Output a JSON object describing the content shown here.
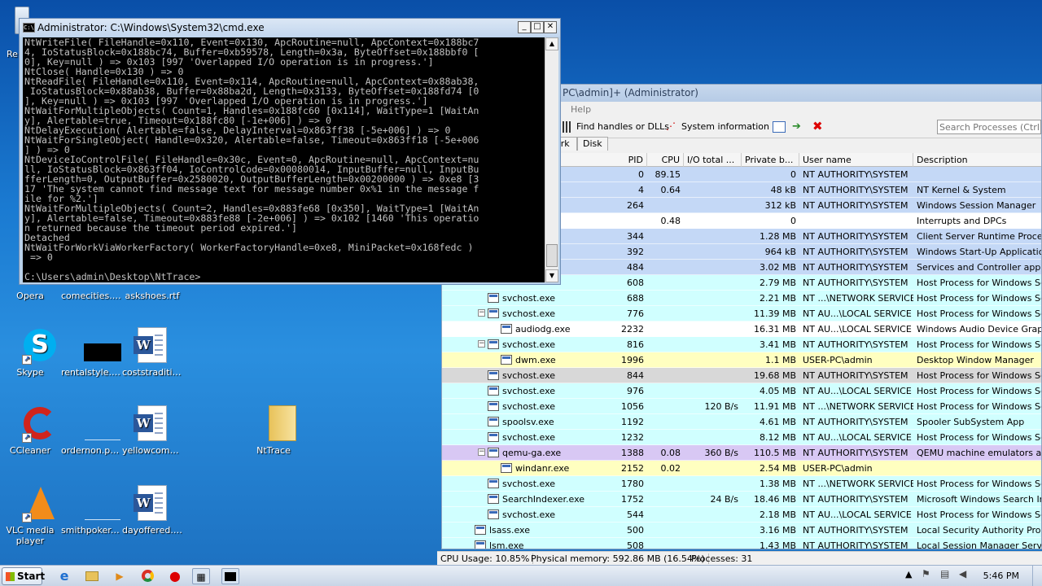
{
  "desktop": {
    "icons": [
      {
        "label": "Opera",
        "name": "opera"
      },
      {
        "label": "comecities.png",
        "name": "comecities"
      },
      {
        "label": "askshoes.rtf",
        "name": "askshoes"
      },
      {
        "label": "Skype",
        "name": "skype"
      },
      {
        "label": "rentalstyle.jpg",
        "name": "rentalstyle"
      },
      {
        "label": "coststraditio...",
        "name": "coststradition"
      },
      {
        "label": "CCleaner",
        "name": "ccleaner"
      },
      {
        "label": "ordernon.png",
        "name": "ordernon"
      },
      {
        "label": "yellowcomm...",
        "name": "yellowcomm"
      },
      {
        "label": "NtTrace",
        "name": "nttrace"
      },
      {
        "label": "VLC media player",
        "name": "vlc"
      },
      {
        "label": "smithpoker....",
        "name": "smithpoker"
      },
      {
        "label": "dayoffered.rtf",
        "name": "dayoffered"
      }
    ],
    "partial_left_label": "Re"
  },
  "cmd": {
    "title": "Administrator: C:\\Windows\\System32\\cmd.exe",
    "lines": [
      "NtWriteFile( FileHandle=0x110, Event=0x130, ApcRoutine=null, ApcContext=0x188bc7",
      "4, IoStatusBlock=0x188bc74, Buffer=0xb59578, Length=0x3a, ByteOffset=0x188bbf0 [",
      "0], Key=null ) => 0x103 [997 'Overlapped I/O operation is in progress.']",
      "NtClose( Handle=0x130 ) => 0",
      "NtReadFile( FileHandle=0x110, Event=0x114, ApcRoutine=null, ApcContext=0x88ab38,",
      " IoStatusBlock=0x88ab38, Buffer=0x88ba2d, Length=0x3133, ByteOffset=0x188fd74 [0",
      "], Key=null ) => 0x103 [997 'Overlapped I/O operation is in progress.']",
      "NtWaitForMultipleObjects( Count=1, Handles=0x188fc60 [0x114], WaitType=1 [WaitAn",
      "y], Alertable=true, Timeout=0x188fc80 [-1e+006] ) => 0",
      "NtDelayExecution( Alertable=false, DelayInterval=0x863ff38 [-5e+006] ) => 0",
      "NtWaitForSingleObject( Handle=0x320, Alertable=false, Timeout=0x863ff18 [-5e+006",
      "] ) => 0",
      "NtDeviceIoControlFile( FileHandle=0x30c, Event=0, ApcRoutine=null, ApcContext=nu",
      "ll, IoStatusBlock=0x863ff04, IoControlCode=0x00080014, InputBuffer=null, InputBu",
      "fferLength=0, OutputBuffer=0x2580020, OutputBufferLength=0x00200000 ) => 0xe8 [3",
      "17 'The system cannot find message text for message number 0x%1 in the message f",
      "ile for %2.']",
      "NtWaitForMultipleObjects( Count=2, Handles=0x883fe68 [0x350], WaitType=1 [WaitAn",
      "y], Alertable=false, Timeout=0x883fe88 [-2e+006] ) => 0x102 [1460 'This operatio",
      "n returned because the timeout period expired.']",
      "Detached",
      "NtWaitForWorkViaWorkerFactory( WorkerFactoryHandle=0xe8, MiniPacket=0x168fedc )",
      " => 0",
      "",
      "C:\\Users\\admin\\Desktop\\NtTrace>"
    ]
  },
  "procexp": {
    "title": "PC\\admin]+ (Administrator)",
    "menu_help": "Help",
    "toolbar": {
      "find_handles": "Find handles or DLLs",
      "system_info": "System information",
      "search_placeholder": "Search Processes (Ctrl+K)"
    },
    "tabs": [
      "ork",
      "Disk"
    ],
    "columns": [
      "PID",
      "CPU",
      "I/O total ...",
      "Private b...",
      "User name",
      "Description"
    ],
    "rows": [
      {
        "indent": 0,
        "name": "",
        "pid": "0",
        "cpu": "89.15",
        "io": "",
        "priv": "0",
        "user": "NT AUTHORITY\\SYSTEM",
        "desc": "",
        "color": "#c4d8f6"
      },
      {
        "indent": 0,
        "name": "",
        "pid": "4",
        "cpu": "0.64",
        "io": "",
        "priv": "48 kB",
        "user": "NT AUTHORITY\\SYSTEM",
        "desc": "NT Kernel & System",
        "color": "#c4d8f6"
      },
      {
        "indent": 0,
        "name": "",
        "pid": "264",
        "cpu": "",
        "io": "",
        "priv": "312 kB",
        "user": "NT AUTHORITY\\SYSTEM",
        "desc": "Windows Session Manager",
        "color": "#c4d8f6"
      },
      {
        "indent": 0,
        "name": "",
        "pid": "",
        "cpu": "0.48",
        "io": "",
        "priv": "0",
        "user": "",
        "desc": "Interrupts and DPCs",
        "color": "#ffffff"
      },
      {
        "indent": 0,
        "name": "",
        "pid": "344",
        "cpu": "",
        "io": "",
        "priv": "1.28 MB",
        "user": "NT AUTHORITY\\SYSTEM",
        "desc": "Client Server Runtime Process",
        "color": "#c4d8f6"
      },
      {
        "indent": 0,
        "name": "",
        "pid": "392",
        "cpu": "",
        "io": "",
        "priv": "964 kB",
        "user": "NT AUTHORITY\\SYSTEM",
        "desc": "Windows Start-Up Application",
        "color": "#c4d8f6"
      },
      {
        "indent": 0,
        "name": "",
        "pid": "484",
        "cpu": "",
        "io": "",
        "priv": "3.02 MB",
        "user": "NT AUTHORITY\\SYSTEM",
        "desc": "Services and Controller app",
        "color": "#c4d8f6"
      },
      {
        "indent": 0,
        "name": "",
        "pid": "608",
        "cpu": "",
        "io": "",
        "priv": "2.79 MB",
        "user": "NT AUTHORITY\\SYSTEM",
        "desc": "Host Process for Windows Servi",
        "color": "#d0ffff"
      },
      {
        "indent": 1,
        "name": "svchost.exe",
        "pid": "688",
        "cpu": "",
        "io": "",
        "priv": "2.21 MB",
        "user": "NT ...\\NETWORK SERVICE",
        "desc": "Host Process for Windows Servi",
        "color": "#d0ffff"
      },
      {
        "indent": 1,
        "expand": true,
        "name": "svchost.exe",
        "pid": "776",
        "cpu": "",
        "io": "",
        "priv": "11.39 MB",
        "user": "NT AU...\\LOCAL SERVICE",
        "desc": "Host Process for Windows Servi",
        "color": "#d0ffff"
      },
      {
        "indent": 2,
        "name": "audiodg.exe",
        "pid": "2232",
        "cpu": "",
        "io": "",
        "priv": "16.31 MB",
        "user": "NT AU...\\LOCAL SERVICE",
        "desc": "Windows Audio Device Graph Is",
        "color": "#ffffff"
      },
      {
        "indent": 1,
        "expand": true,
        "name": "svchost.exe",
        "pid": "816",
        "cpu": "",
        "io": "",
        "priv": "3.41 MB",
        "user": "NT AUTHORITY\\SYSTEM",
        "desc": "Host Process for Windows Servi",
        "color": "#d0ffff"
      },
      {
        "indent": 2,
        "name": "dwm.exe",
        "pid": "1996",
        "cpu": "",
        "io": "",
        "priv": "1.1 MB",
        "user": "USER-PC\\admin",
        "desc": "Desktop Window Manager",
        "color": "#ffffc0"
      },
      {
        "indent": 1,
        "name": "svchost.exe",
        "pid": "844",
        "cpu": "",
        "io": "",
        "priv": "19.68 MB",
        "user": "NT AUTHORITY\\SYSTEM",
        "desc": "Host Process for Windows Servi",
        "color": "#d8d8d8"
      },
      {
        "indent": 1,
        "name": "svchost.exe",
        "pid": "976",
        "cpu": "",
        "io": "",
        "priv": "4.05 MB",
        "user": "NT AU...\\LOCAL SERVICE",
        "desc": "Host Process for Windows Servi",
        "color": "#d0ffff"
      },
      {
        "indent": 1,
        "name": "svchost.exe",
        "pid": "1056",
        "cpu": "",
        "io": "120 B/s",
        "priv": "11.91 MB",
        "user": "NT ...\\NETWORK SERVICE",
        "desc": "Host Process for Windows Servi",
        "color": "#d0ffff"
      },
      {
        "indent": 1,
        "name": "spoolsv.exe",
        "pid": "1192",
        "cpu": "",
        "io": "",
        "priv": "4.61 MB",
        "user": "NT AUTHORITY\\SYSTEM",
        "desc": "Spooler SubSystem App",
        "color": "#d0ffff"
      },
      {
        "indent": 1,
        "name": "svchost.exe",
        "pid": "1232",
        "cpu": "",
        "io": "",
        "priv": "8.12 MB",
        "user": "NT AU...\\LOCAL SERVICE",
        "desc": "Host Process for Windows Servi",
        "color": "#d0ffff"
      },
      {
        "indent": 1,
        "expand": true,
        "name": "qemu-ga.exe",
        "pid": "1388",
        "cpu": "0.08",
        "io": "360 B/s",
        "priv": "110.5 MB",
        "user": "NT AUTHORITY\\SYSTEM",
        "desc": "QEMU machine emulators and to",
        "color": "#d8c8f4"
      },
      {
        "indent": 2,
        "name": "windanr.exe",
        "pid": "2152",
        "cpu": "0.02",
        "io": "",
        "priv": "2.54 MB",
        "user": "USER-PC\\admin",
        "desc": "",
        "color": "#ffffc0"
      },
      {
        "indent": 1,
        "name": "svchost.exe",
        "pid": "1780",
        "cpu": "",
        "io": "",
        "priv": "1.38 MB",
        "user": "NT ...\\NETWORK SERVICE",
        "desc": "Host Process for Windows Servi",
        "color": "#d0ffff"
      },
      {
        "indent": 1,
        "name": "SearchIndexer.exe",
        "pid": "1752",
        "cpu": "",
        "io": "24 B/s",
        "priv": "18.46 MB",
        "user": "NT AUTHORITY\\SYSTEM",
        "desc": "Microsoft Windows Search Index",
        "color": "#d0ffff"
      },
      {
        "indent": 1,
        "name": "svchost.exe",
        "pid": "544",
        "cpu": "",
        "io": "",
        "priv": "2.18 MB",
        "user": "NT AU...\\LOCAL SERVICE",
        "desc": "Host Process for Windows Servi",
        "color": "#d0ffff"
      },
      {
        "indent": 0,
        "name": "lsass.exe",
        "pid": "500",
        "cpu": "",
        "io": "",
        "priv": "3.16 MB",
        "user": "NT AUTHORITY\\SYSTEM",
        "desc": "Local Security Authority Process",
        "color": "#d0ffff"
      },
      {
        "indent": 0,
        "name": "lsm.exe",
        "pid": "508",
        "cpu": "",
        "io": "",
        "priv": "1.43 MB",
        "user": "NT AUTHORITY\\SYSTEM",
        "desc": "Local Session Manager Service",
        "color": "#d0ffff"
      }
    ],
    "status": {
      "cpu": "CPU Usage: 10.85%",
      "memory": "Physical memory: 592.86 MB (16.54%)",
      "processes": "Processes: 31"
    }
  },
  "taskbar": {
    "start_label": "Start",
    "clock": "5:46 PM"
  }
}
